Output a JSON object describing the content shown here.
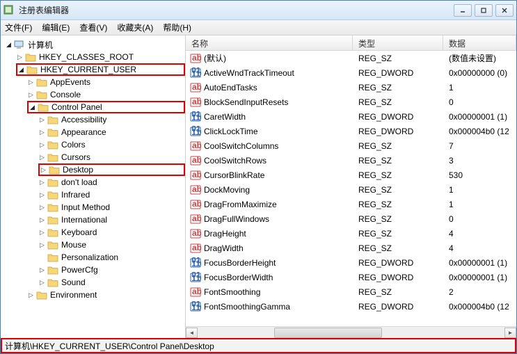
{
  "window": {
    "title": "注册表编辑器"
  },
  "menu": {
    "file": "文件(F)",
    "edit": "编辑(E)",
    "view": "查看(V)",
    "fav": "收藏夹(A)",
    "help": "帮助(H)"
  },
  "tree": {
    "root": "计算机",
    "k0": "HKEY_CLASSES_ROOT",
    "k1": "HKEY_CURRENT_USER",
    "k1_0": "AppEvents",
    "k1_1": "Console",
    "k1_2": "Control Panel",
    "cp0": "Accessibility",
    "cp1": "Appearance",
    "cp2": "Colors",
    "cp3": "Cursors",
    "cp4": "Desktop",
    "cp5": "don't load",
    "cp6": "Infrared",
    "cp7": "Input Method",
    "cp8": "International",
    "cp9": "Keyboard",
    "cp10": "Mouse",
    "cp11": "Personalization",
    "cp12": "PowerCfg",
    "cp13": "Sound",
    "k1_3": "Environment"
  },
  "columns": {
    "name": "名称",
    "type": "类型",
    "data": "数据"
  },
  "rows": [
    {
      "kind": "sz",
      "name": "(默认)",
      "type": "REG_SZ",
      "data": "(数值未设置)"
    },
    {
      "kind": "dw",
      "name": "ActiveWndTrackTimeout",
      "type": "REG_DWORD",
      "data": "0x00000000 (0)"
    },
    {
      "kind": "sz",
      "name": "AutoEndTasks",
      "type": "REG_SZ",
      "data": "1"
    },
    {
      "kind": "sz",
      "name": "BlockSendInputResets",
      "type": "REG_SZ",
      "data": "0"
    },
    {
      "kind": "dw",
      "name": "CaretWidth",
      "type": "REG_DWORD",
      "data": "0x00000001 (1)"
    },
    {
      "kind": "dw",
      "name": "ClickLockTime",
      "type": "REG_DWORD",
      "data": "0x000004b0 (12"
    },
    {
      "kind": "sz",
      "name": "CoolSwitchColumns",
      "type": "REG_SZ",
      "data": "7"
    },
    {
      "kind": "sz",
      "name": "CoolSwitchRows",
      "type": "REG_SZ",
      "data": "3"
    },
    {
      "kind": "sz",
      "name": "CursorBlinkRate",
      "type": "REG_SZ",
      "data": "530"
    },
    {
      "kind": "sz",
      "name": "DockMoving",
      "type": "REG_SZ",
      "data": "1"
    },
    {
      "kind": "sz",
      "name": "DragFromMaximize",
      "type": "REG_SZ",
      "data": "1"
    },
    {
      "kind": "sz",
      "name": "DragFullWindows",
      "type": "REG_SZ",
      "data": "0"
    },
    {
      "kind": "sz",
      "name": "DragHeight",
      "type": "REG_SZ",
      "data": "4"
    },
    {
      "kind": "sz",
      "name": "DragWidth",
      "type": "REG_SZ",
      "data": "4"
    },
    {
      "kind": "dw",
      "name": "FocusBorderHeight",
      "type": "REG_DWORD",
      "data": "0x00000001 (1)"
    },
    {
      "kind": "dw",
      "name": "FocusBorderWidth",
      "type": "REG_DWORD",
      "data": "0x00000001 (1)"
    },
    {
      "kind": "sz",
      "name": "FontSmoothing",
      "type": "REG_SZ",
      "data": "2"
    },
    {
      "kind": "dw",
      "name": "FontSmoothingGamma",
      "type": "REG_DWORD",
      "data": "0x000004b0 (12"
    }
  ],
  "status": {
    "path": "计算机\\HKEY_CURRENT_USER\\Control Panel\\Desktop"
  }
}
